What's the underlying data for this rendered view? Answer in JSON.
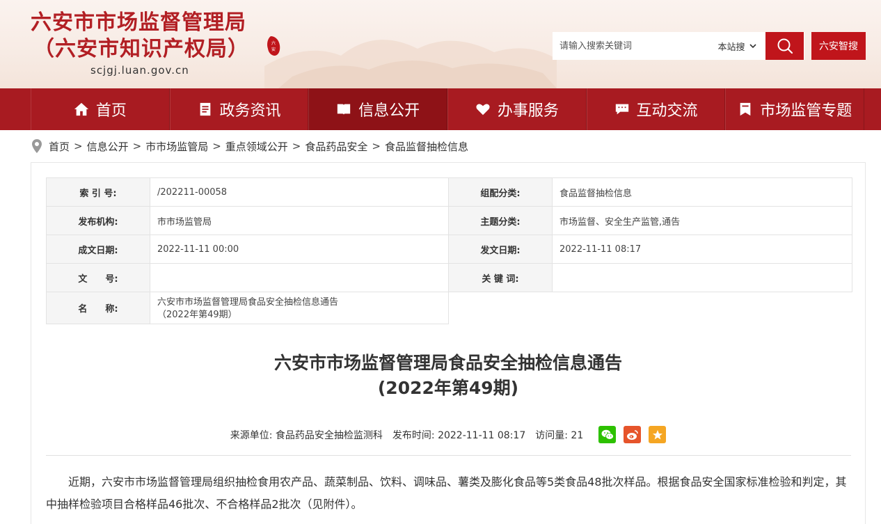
{
  "header": {
    "title_line1": "六安市市场监督管理局",
    "title_line2": "（六安市知识产权局）",
    "url": "scjgj.luan.gov.cn",
    "search_placeholder": "请输入搜索关键词",
    "search_scope": "本站搜",
    "button_zhigou": "六安智搜",
    "brand_color": "#b21f24"
  },
  "nav": {
    "items": [
      {
        "label": "首页",
        "icon": "home-icon"
      },
      {
        "label": "政务资讯",
        "icon": "document-icon"
      },
      {
        "label": "信息公开",
        "icon": "open-book-icon"
      },
      {
        "label": "办事服务",
        "icon": "heart-icon"
      },
      {
        "label": "互动交流",
        "icon": "chat-icon"
      },
      {
        "label": "市场监管专题",
        "icon": "bookmark-icon"
      }
    ],
    "active": "信息公开"
  },
  "breadcrumb": [
    "首页",
    "信息公开",
    "市市场监管局",
    "重点领域公开",
    "食品药品安全",
    "食品监督抽检信息"
  ],
  "meta": {
    "index_label": "索 引 号:",
    "index_value": "/202211-00058",
    "category_label": "组配分类:",
    "category_value": "食品监督抽检信息",
    "publisher_label": "发布机构:",
    "publisher_value": "市市场监管局",
    "topic_label": "主题分类:",
    "topic_value": "市场监督、安全生产监管,通告",
    "created_label": "成文日期:",
    "created_value": "2022-11-11 00:00",
    "issued_label": "发文日期:",
    "issued_value": "2022-11-11 08:17",
    "docno_label": "文　　号:",
    "docno_value": "",
    "keywords_label": "关 键 词:",
    "keywords_value": "",
    "name_label": "名　　称:",
    "name_value_line1": "六安市市场监督管理局食品安全抽检信息通告",
    "name_value_line2": "（2022年第49期）"
  },
  "article": {
    "title_line1": "六安市市场监督管理局食品安全抽检信息通告",
    "title_line2": "(2022年第49期)",
    "source_label": "来源单位:",
    "source_value": "食品药品安全抽检监测科",
    "time_label": "发布时间:",
    "time_value": "2022-11-11 08:17",
    "views_label": "访问量:",
    "views_value": "21",
    "paragraph1": "近期，六安市市场监督管理局组织抽检食用农产品、蔬菜制品、饮料、调味品、薯类及膨化食品等5类食品48批次样品。根据食品安全国家标准检验和判定，其中抽样检验项目合格样品46批次、不合格样品2批次（见附件）。"
  },
  "share": [
    {
      "icon": "wechat-icon",
      "color": "#2dc100"
    },
    {
      "icon": "weibo-icon",
      "color": "#e6542b"
    },
    {
      "icon": "favorite-star-icon",
      "color": "#f5a623"
    }
  ]
}
